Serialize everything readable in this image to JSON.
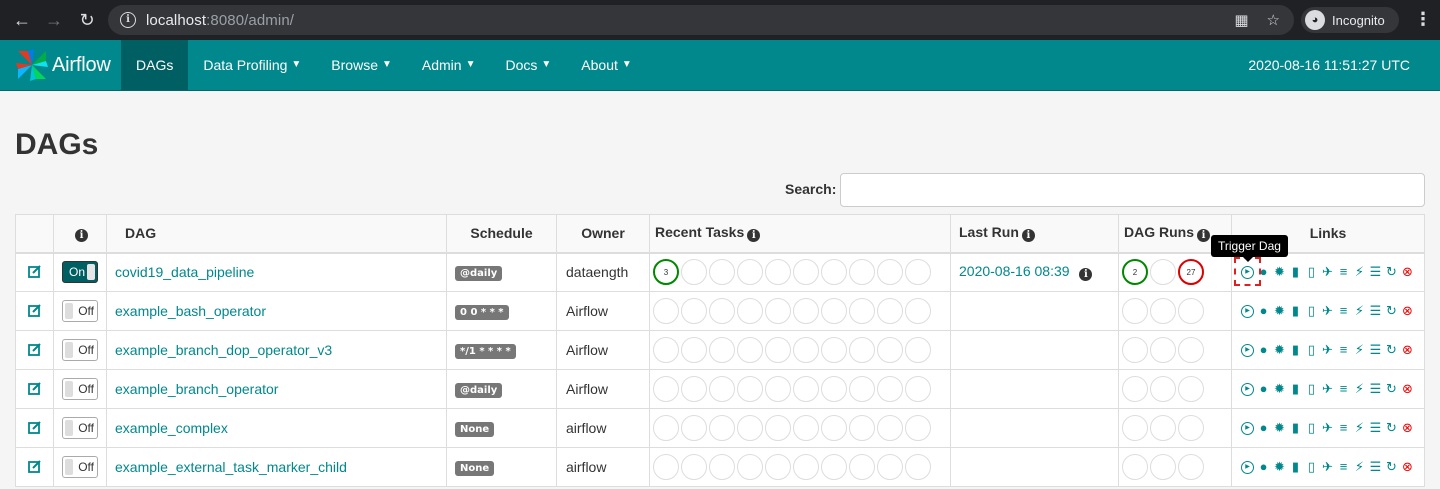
{
  "browser": {
    "url_host": "localhost",
    "url_rest": ":8080/admin/",
    "incognito_label": "Incognito"
  },
  "navbar": {
    "brand": "Airflow",
    "items": [
      {
        "label": "DAGs",
        "caret": false
      },
      {
        "label": "Data Profiling",
        "caret": true
      },
      {
        "label": "Browse",
        "caret": true
      },
      {
        "label": "Admin",
        "caret": true
      },
      {
        "label": "Docs",
        "caret": true
      },
      {
        "label": "About",
        "caret": true
      }
    ],
    "clock": "2020-08-16 11:51:27 UTC"
  },
  "page": {
    "title": "DAGs",
    "search_label": "Search:",
    "search_value": ""
  },
  "table": {
    "headers": {
      "dag": "DAG",
      "schedule": "Schedule",
      "owner": "Owner",
      "recent_tasks": "Recent Tasks",
      "last_run": "Last Run",
      "dag_runs": "DAG Runs",
      "links": "Links"
    },
    "rows": [
      {
        "toggle": "On",
        "dag": "covid19_data_pipeline",
        "schedule": "@daily",
        "owner": "dataength",
        "recent_first": "3",
        "last_run": "2020-08-16 08:39",
        "runs_success": "2",
        "runs_failed": "27"
      },
      {
        "toggle": "Off",
        "dag": "example_bash_operator",
        "schedule": "0 0 * * *",
        "owner": "Airflow"
      },
      {
        "toggle": "Off",
        "dag": "example_branch_dop_operator_v3",
        "schedule": "*/1 * * * *",
        "owner": "Airflow"
      },
      {
        "toggle": "Off",
        "dag": "example_branch_operator",
        "schedule": "@daily",
        "owner": "Airflow"
      },
      {
        "toggle": "Off",
        "dag": "example_complex",
        "schedule": "None",
        "owner": "airflow"
      },
      {
        "toggle": "Off",
        "dag": "example_external_task_marker_child",
        "schedule": "None",
        "owner": "airflow"
      }
    ]
  },
  "tooltip": "Trigger Dag",
  "colors": {
    "navbar": "#00888d",
    "active": "#005f62",
    "success": "#008000",
    "failed": "#dd0000"
  }
}
